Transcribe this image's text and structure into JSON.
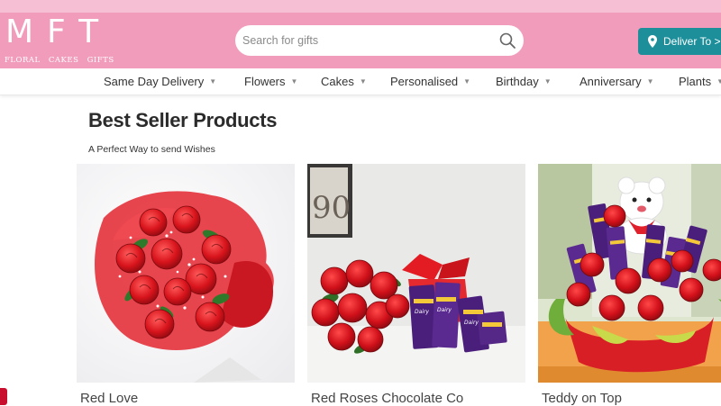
{
  "brand": {
    "letters": "MFT",
    "tagline": "FLORAL CAKES GIFTS",
    "text_color": "#ffffff",
    "header_color": "#f19cbb",
    "strip_color": "#f6bfd3"
  },
  "search": {
    "placeholder": "Search for gifts",
    "value": "",
    "icon": "search-icon"
  },
  "deliver": {
    "label": "Deliver To >",
    "icon": "location-pin-icon",
    "color": "#1d8f9b"
  },
  "nav": {
    "items": [
      {
        "label": "Same Day Delivery"
      },
      {
        "label": "Flowers"
      },
      {
        "label": "Cakes"
      },
      {
        "label": "Personalised"
      },
      {
        "label": "Birthday"
      },
      {
        "label": "Anniversary"
      },
      {
        "label": "Plants"
      }
    ]
  },
  "section": {
    "title": "Best Seller Products",
    "subtitle": "A Perfect Way to send Wishes"
  },
  "products": [
    {
      "name": "Red Love",
      "image": "red-rose-bouquet-image"
    },
    {
      "name": "Red Roses Chocolate Co",
      "image": "roses-chocolate-combo-image"
    },
    {
      "name": "Teddy on Top",
      "image": "teddy-roses-arrangement-image"
    }
  ]
}
